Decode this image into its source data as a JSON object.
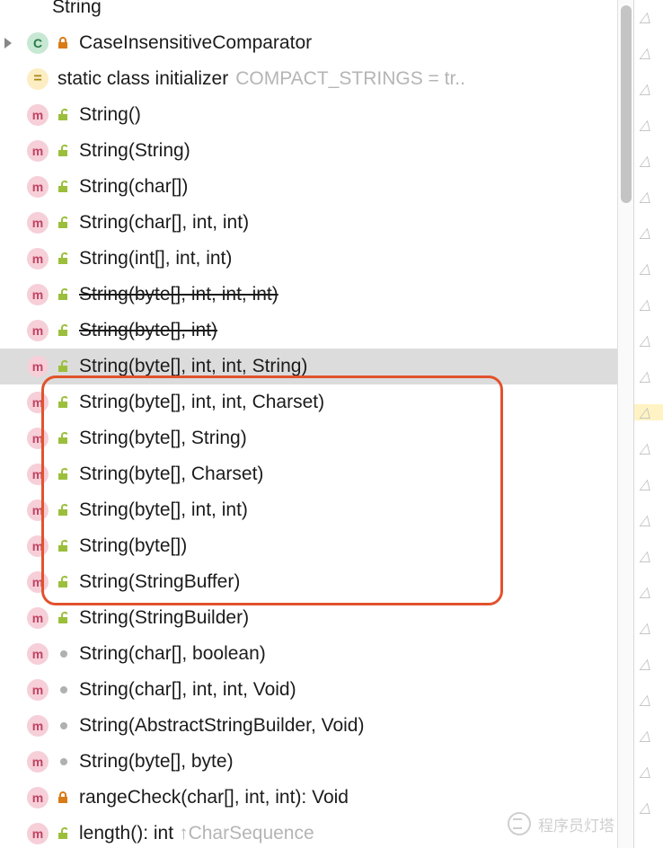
{
  "top_partial_label": "String",
  "class_item": {
    "label": "CaseInsensitiveComparator"
  },
  "initializer": {
    "label": "static class initializer",
    "trail": "COMPACT_STRINGS = tr.."
  },
  "methods": [
    {
      "label": "String()",
      "vis": "open",
      "depr": false,
      "sel": false,
      "hi": false
    },
    {
      "label": "String(String)",
      "vis": "open",
      "depr": false,
      "sel": false,
      "hi": false
    },
    {
      "label": "String(char[])",
      "vis": "open",
      "depr": false,
      "sel": false,
      "hi": false
    },
    {
      "label": "String(char[], int, int)",
      "vis": "open",
      "depr": false,
      "sel": false,
      "hi": false
    },
    {
      "label": "String(int[], int, int)",
      "vis": "open",
      "depr": false,
      "sel": false,
      "hi": false
    },
    {
      "label": "String(byte[], int, int, int)",
      "vis": "open",
      "depr": true,
      "sel": false,
      "hi": false
    },
    {
      "label": "String(byte[], int)",
      "vis": "open",
      "depr": true,
      "sel": false,
      "hi": false
    },
    {
      "label": "String(byte[], int, int, String)",
      "vis": "open",
      "depr": false,
      "sel": true,
      "hi": true
    },
    {
      "label": "String(byte[], int, int, Charset)",
      "vis": "open",
      "depr": false,
      "sel": false,
      "hi": true
    },
    {
      "label": "String(byte[], String)",
      "vis": "open",
      "depr": false,
      "sel": false,
      "hi": true
    },
    {
      "label": "String(byte[], Charset)",
      "vis": "open",
      "depr": false,
      "sel": false,
      "hi": true
    },
    {
      "label": "String(byte[], int, int)",
      "vis": "open",
      "depr": false,
      "sel": false,
      "hi": true
    },
    {
      "label": "String(byte[])",
      "vis": "open",
      "depr": false,
      "sel": false,
      "hi": true
    },
    {
      "label": "String(StringBuffer)",
      "vis": "open",
      "depr": false,
      "sel": false,
      "hi": false
    },
    {
      "label": "String(StringBuilder)",
      "vis": "open",
      "depr": false,
      "sel": false,
      "hi": false
    },
    {
      "label": "String(char[], boolean)",
      "vis": "pkg",
      "depr": false,
      "sel": false,
      "hi": false
    },
    {
      "label": "String(char[], int, int, Void)",
      "vis": "pkg",
      "depr": false,
      "sel": false,
      "hi": false
    },
    {
      "label": "String(AbstractStringBuilder, Void)",
      "vis": "pkg",
      "depr": false,
      "sel": false,
      "hi": false
    },
    {
      "label": "String(byte[], byte)",
      "vis": "pkg",
      "depr": false,
      "sel": false,
      "hi": false
    },
    {
      "label": "rangeCheck(char[], int, int): Void",
      "vis": "lock",
      "depr": false,
      "sel": false,
      "hi": false
    },
    {
      "label": "length(): int",
      "vis": "open",
      "depr": false,
      "sel": false,
      "hi": false,
      "super": "↑CharSequence"
    }
  ],
  "watermark": "程序员灯塔"
}
